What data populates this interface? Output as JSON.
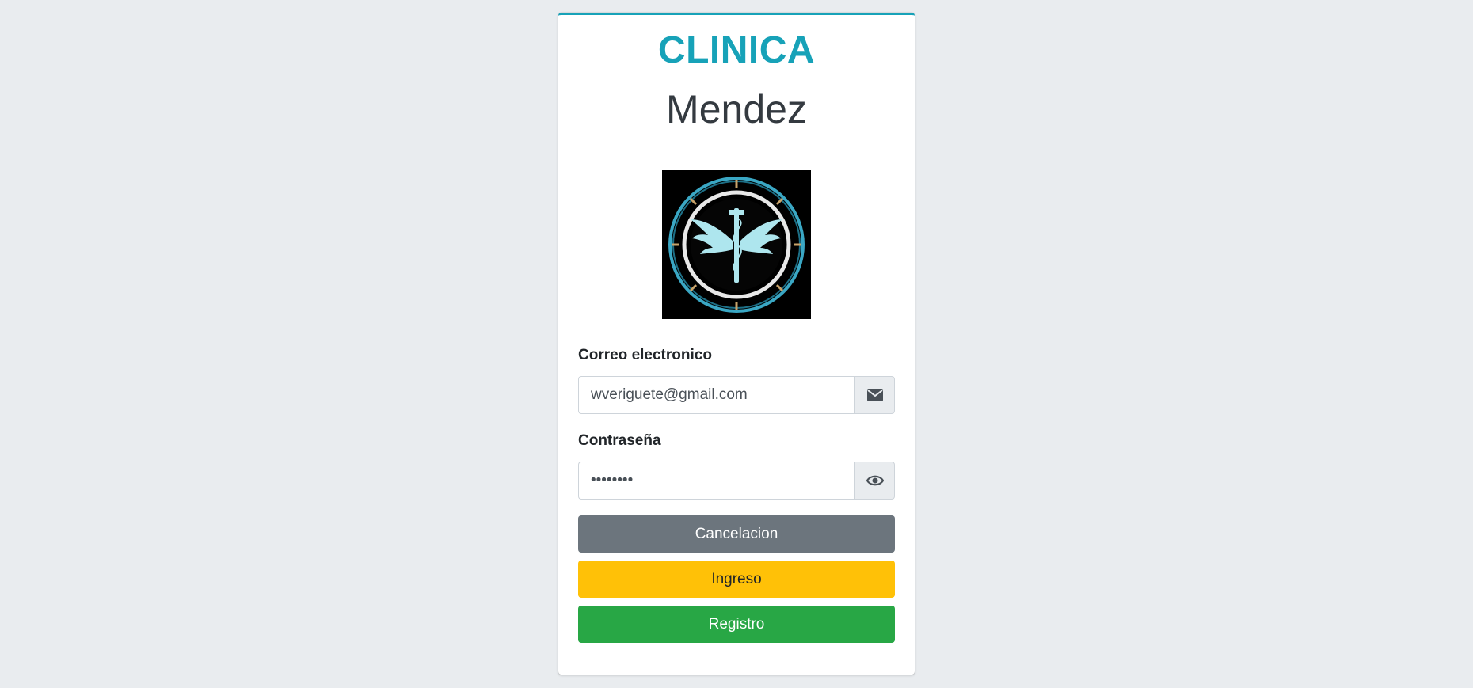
{
  "brand": {
    "title": "CLINICA",
    "subtitle": "Mendez",
    "accent_color": "#17a2b8"
  },
  "logo": {
    "icon": "caduceus-emblem-icon"
  },
  "form": {
    "email": {
      "label": "Correo electronico",
      "value": "wveriguete@gmail.com",
      "icon": "envelope-icon"
    },
    "password": {
      "label": "Contraseña",
      "value": "••••••••",
      "icon": "eye-icon"
    }
  },
  "buttons": {
    "cancel_label": "Cancelacion",
    "login_label": "Ingreso",
    "register_label": "Registro"
  },
  "colors": {
    "cancel": "#6c757d",
    "login": "#ffc107",
    "register": "#28a745",
    "background": "#e9ecef"
  }
}
